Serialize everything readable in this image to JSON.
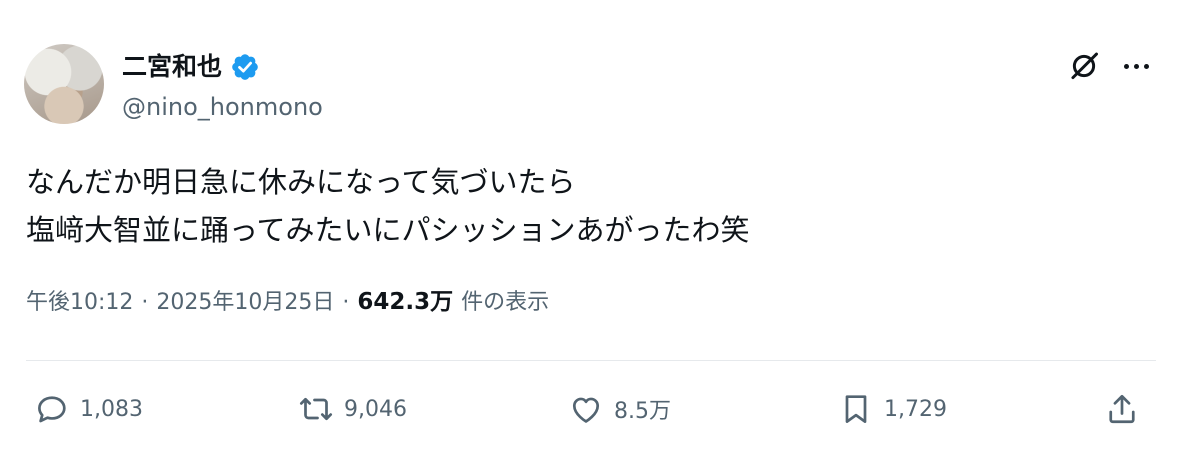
{
  "author": {
    "display_name": "二宮和也",
    "handle": "@nino_honmono",
    "verified": true,
    "verified_color": "#1d9bf0"
  },
  "tweet": {
    "lines": [
      "なんだか明日急に休みになって気づいたら",
      "塩﨑大智並に踊ってみたいにパシッションあがったわ笑"
    ]
  },
  "meta": {
    "time": "午後10:12",
    "separator": "·",
    "date": "2025年10月25日",
    "views_count": "642.3万",
    "views_label": "件の表示"
  },
  "actions": {
    "reply_count": "1,083",
    "retweet_count": "9,046",
    "like_count": "8.5万",
    "bookmark_count": "1,729"
  },
  "icons": [
    "grok-icon",
    "more-icon",
    "reply-icon",
    "retweet-icon",
    "like-icon",
    "bookmark-icon",
    "share-icon",
    "verified-badge-icon"
  ]
}
